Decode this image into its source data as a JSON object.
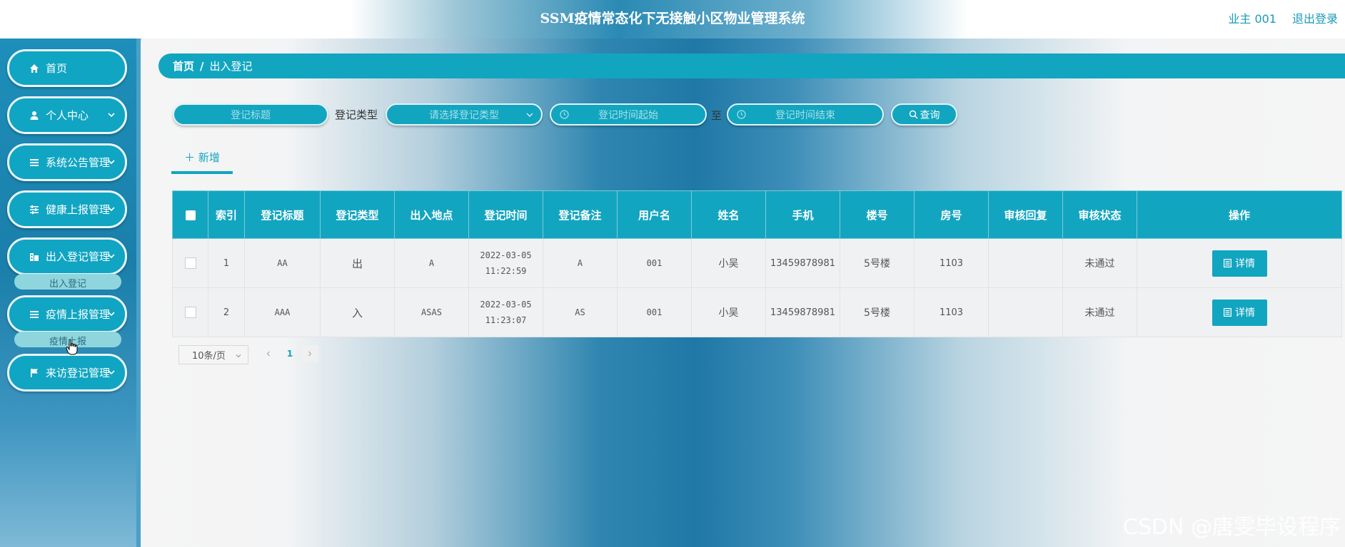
{
  "header": {
    "title": "SSM疫情常态化下无接触小区物业管理系统",
    "user": "业主 001",
    "logout": "退出登录"
  },
  "sidebar": {
    "items": [
      {
        "label": "首页",
        "icon": "home-icon"
      },
      {
        "label": "个人中心",
        "icon": "person-icon"
      },
      {
        "label": "系统公告管理",
        "icon": "list-icon"
      },
      {
        "label": "健康上报管理",
        "icon": "sliders-icon"
      },
      {
        "label": "出入登记管理",
        "icon": "building-icon"
      },
      {
        "label": "疫情上报管理",
        "icon": "list-icon"
      },
      {
        "label": "来访登记管理",
        "icon": "flag-icon"
      }
    ],
    "sub_items": [
      "出入登记",
      "疫情上报"
    ]
  },
  "breadcrumb": {
    "home": "首页",
    "separator": "/",
    "current": "出入登记"
  },
  "search": {
    "title_placeholder": "登记标题",
    "type_label": "登记类型",
    "type_placeholder": "请选择登记类型",
    "start_placeholder": "登记时间起始",
    "to_label": "至",
    "end_placeholder": "登记时间结束",
    "query_label": "查询"
  },
  "toolbar": {
    "add_label": "＋ 新增"
  },
  "table": {
    "headers": [
      "索引",
      "登记标题",
      "登记类型",
      "出入地点",
      "登记时间",
      "登记备注",
      "用户名",
      "姓名",
      "手机",
      "楼号",
      "房号",
      "审核回复",
      "审核状态",
      "操作"
    ],
    "rows": [
      {
        "index": "1",
        "title": "AA",
        "type": "出",
        "place": "A",
        "date": "2022-03-05",
        "time": "11:22:59",
        "remark": "A",
        "username": "001",
        "name": "小吴",
        "phone": "13459878981",
        "building": "5号楼",
        "room": "1103",
        "reply": "",
        "status": "未通过",
        "action": "详情"
      },
      {
        "index": "2",
        "title": "AAA",
        "type": "入",
        "place": "ASAS",
        "date": "2022-03-05",
        "time": "11:23:07",
        "remark": "AS",
        "username": "001",
        "name": "小吴",
        "phone": "13459878981",
        "building": "5号楼",
        "room": "1103",
        "reply": "",
        "status": "未通过",
        "action": "详情"
      }
    ]
  },
  "pagination": {
    "page_size": "10条/页",
    "current_page": "1"
  },
  "watermark": "CSDN @唐雯毕设程序",
  "colors": {
    "accent": "#12a5c0",
    "sidebar": "#1d8fba",
    "link": "#1a9bb5"
  }
}
